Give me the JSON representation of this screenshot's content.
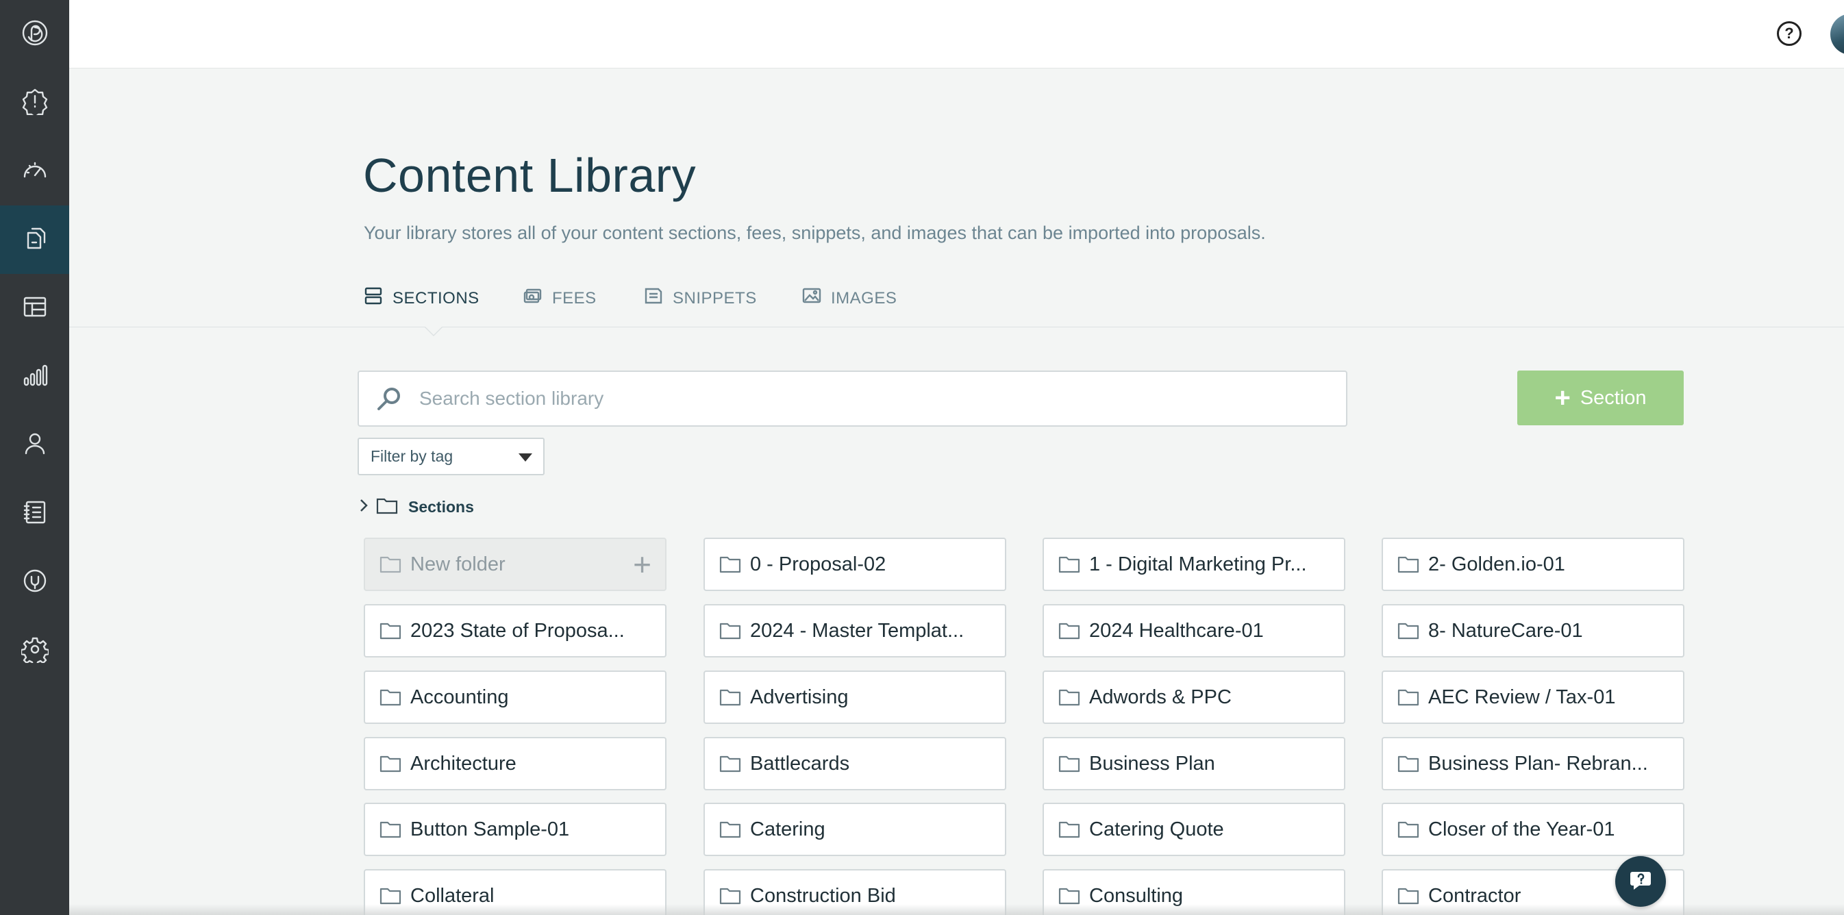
{
  "sidebar": {
    "items": [
      {
        "icon": "logo-icon",
        "active": false
      },
      {
        "icon": "alert-badge-icon",
        "active": false
      },
      {
        "icon": "dashboard-gauge-icon",
        "active": false
      },
      {
        "icon": "content-library-icon",
        "active": true
      },
      {
        "icon": "templates-icon",
        "active": false
      },
      {
        "icon": "reports-chart-icon",
        "active": false
      },
      {
        "icon": "user-icon",
        "active": false
      },
      {
        "icon": "contacts-book-icon",
        "active": false
      },
      {
        "icon": "integrations-icon",
        "active": false
      },
      {
        "icon": "settings-gear-icon",
        "active": false
      }
    ]
  },
  "topbar": {
    "help_label": "?"
  },
  "header": {
    "title": "Content Library",
    "subtitle": "Your library stores all of your content sections, fees, snippets, and images that can be imported into proposals."
  },
  "tabs": [
    {
      "label": "SECTIONS",
      "icon": "sections-icon",
      "active": true
    },
    {
      "label": "FEES",
      "icon": "fees-icon",
      "active": false
    },
    {
      "label": "SNIPPETS",
      "icon": "snippets-icon",
      "active": false
    },
    {
      "label": "IMAGES",
      "icon": "images-icon",
      "active": false
    }
  ],
  "search": {
    "placeholder": "Search section library"
  },
  "add_button": {
    "plus": "+",
    "label": "Section"
  },
  "filter": {
    "label": "Filter by tag"
  },
  "breadcrumb": {
    "label": "Sections"
  },
  "new_folder": {
    "label": "New folder",
    "plus": "+"
  },
  "folders": [
    "0 - Proposal-02",
    "1 - Digital Marketing Pr...",
    "2- Golden.io-01",
    "2023 State of Proposa...",
    "2024 - Master Templat...",
    "2024 Healthcare-01",
    "8- NatureCare-01",
    "Accounting",
    "Advertising",
    "Adwords & PPC",
    "AEC Review / Tax-01",
    "Architecture",
    "Battlecards",
    "Business Plan",
    "Business Plan- Rebran...",
    "Button Sample-01",
    "Catering",
    "Catering Quote",
    "Closer of the Year-01",
    "Collateral",
    "Construction Bid",
    "Consulting",
    "Contractor"
  ],
  "colors": {
    "sidebar_bg": "#33373a",
    "sidebar_active": "#1d4250",
    "accent_green": "#9fd08a",
    "title_color": "#1f3f4d"
  }
}
